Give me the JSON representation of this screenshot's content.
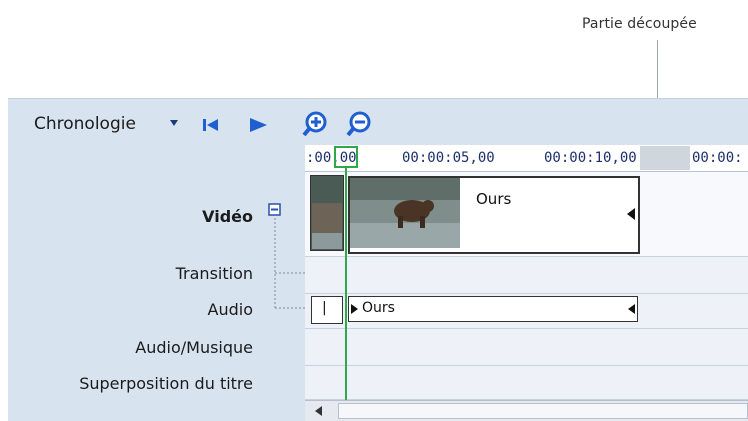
{
  "callout": {
    "label": "Partie découpée"
  },
  "toolbar": {
    "view_label": "Chronologie",
    "buttons": [
      "Précédent",
      "Lecture",
      "Zoom avant",
      "Zoom arrière"
    ]
  },
  "ruler": {
    "ticks": [
      ":00,00",
      "00:00:05,00",
      "00:00:10,00",
      "00:00:"
    ]
  },
  "tracks": {
    "video": "Vidéo",
    "transition": "Transition",
    "audio": "Audio",
    "music": "Audio/Musique",
    "title_overlay": "Superposition du titre"
  },
  "clips": {
    "video_clip": "Ours",
    "audio_clip": "Ours"
  }
}
